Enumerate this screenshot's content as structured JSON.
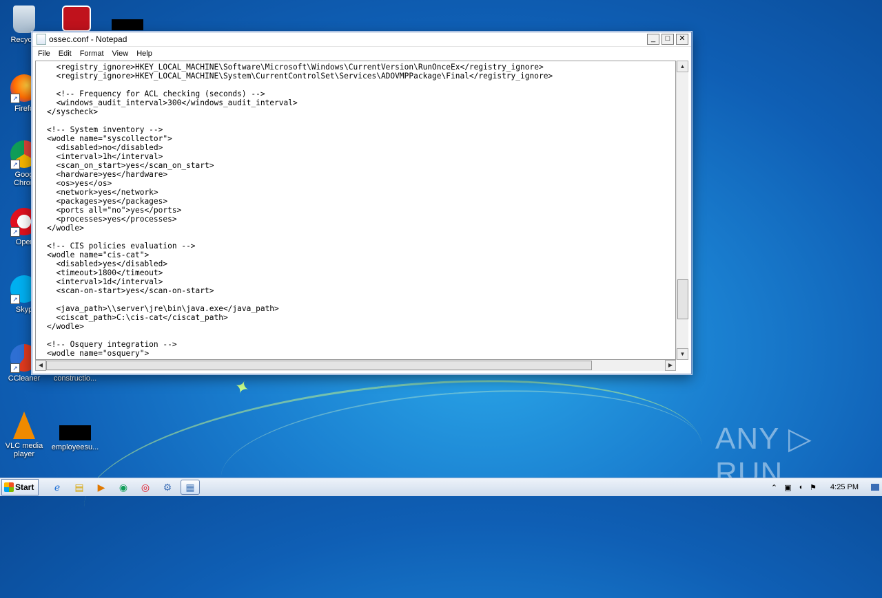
{
  "desktop": {
    "icons": [
      {
        "label": "Recycle"
      },
      {
        "label": "Firefo"
      },
      {
        "label": "Goog\nChron"
      },
      {
        "label": "Oper"
      },
      {
        "label": "Skyp"
      },
      {
        "label": "CCleaner"
      },
      {
        "label": "constructio..."
      },
      {
        "label": "VLC media\nplayer"
      },
      {
        "label": "employeesu..."
      }
    ],
    "watermark": "ANY ▷ RUN"
  },
  "window": {
    "title": "ossec.conf - Notepad",
    "minimize": "_",
    "maximize": "□",
    "close": "✕",
    "menu": [
      "File",
      "Edit",
      "Format",
      "View",
      "Help"
    ],
    "content": "  <registry_ignore>HKEY_LOCAL_MACHINE\\Software\\Microsoft\\Windows\\CurrentVersion\\RunOnceEx</registry_ignore>\n  <registry_ignore>HKEY_LOCAL_MACHINE\\System\\CurrentControlSet\\Services\\ADOVMPPackage\\Final</registry_ignore>\n\n  <!-- Frequency for ACL checking (seconds) -->\n  <windows_audit_interval>300</windows_audit_interval>\n</syscheck>\n\n<!-- System inventory -->\n<wodle name=\"syscollector\">\n  <disabled>no</disabled>\n  <interval>1h</interval>\n  <scan_on_start>yes</scan_on_start>\n  <hardware>yes</hardware>\n  <os>yes</os>\n  <network>yes</network>\n  <packages>yes</packages>\n  <ports all=\"no\">yes</ports>\n  <processes>yes</processes>\n</wodle>\n\n<!-- CIS policies evaluation -->\n<wodle name=\"cis-cat\">\n  <disabled>yes</disabled>\n  <timeout>1800</timeout>\n  <interval>1d</interval>\n  <scan-on-start>yes</scan-on-start>\n\n  <java_path>\\\\server\\jre\\bin\\java.exe</java_path>\n  <ciscat_path>C:\\cis-cat</ciscat_path>\n</wodle>\n\n<!-- Osquery integration -->\n<wodle name=\"osquery\">"
  },
  "taskbar": {
    "start_label": "Start",
    "clock": "4:25 PM"
  }
}
